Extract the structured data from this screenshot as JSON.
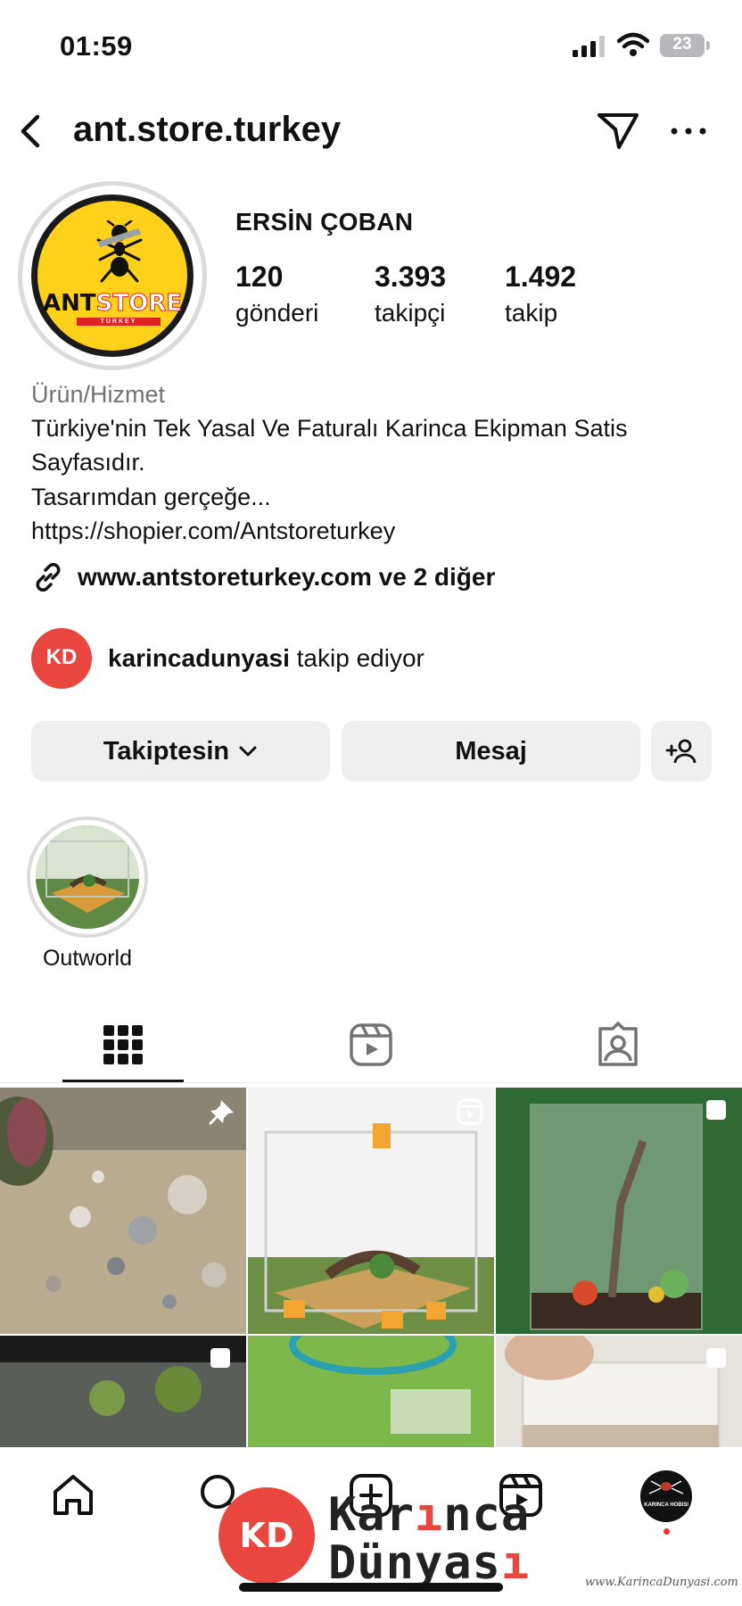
{
  "status_bar": {
    "time": "01:59",
    "battery": "23"
  },
  "header": {
    "username": "ant.store.turkey"
  },
  "profile": {
    "avatar_brand_left": "ANT",
    "avatar_brand_right": "STORE",
    "avatar_sub": "TURKEY",
    "display_name": "ERSİN ÇOBAN",
    "stats": [
      {
        "value": "120",
        "label": "gönderi"
      },
      {
        "value": "3.393",
        "label": "takipçi"
      },
      {
        "value": "1.492",
        "label": "takip"
      }
    ],
    "category": "Ürün/Hizmet",
    "bio_lines": [
      "Türkiye'nin Tek Yasal Ve Faturalı Karinca Ekipman Satis",
      "Sayfasıdır.",
      "Tasarımdan gerçeğe...",
      "https://shopier.com/Antstoreturkey"
    ],
    "link_text": "www.antstoreturkey.com ve 2 diğer",
    "mutual": {
      "avatar_text": "KD",
      "name": "karincadunyasi",
      "suffix": "takip ediyor"
    }
  },
  "actions": {
    "follow_label": "Takiptesin",
    "message_label": "Mesaj"
  },
  "highlights": [
    {
      "label": "Outworld"
    }
  ],
  "tabs": [
    {
      "name": "grid",
      "icon": "grid-icon",
      "active": true
    },
    {
      "name": "reels",
      "icon": "reels-icon",
      "active": false
    },
    {
      "name": "tagged",
      "icon": "tagged-icon",
      "active": false
    }
  ],
  "bottom_nav": {
    "profile_mini_text": "KARINCA HOBISI"
  },
  "watermark": {
    "logo": "KD",
    "line1_a": "Kar",
    "line1_b": "ı",
    "line1_c": "nca",
    "line2_a": "Dünyas",
    "line2_b": "ı",
    "url": "www.KarincaDunyasi.com"
  },
  "colors": {
    "accent_red": "#e8463e",
    "button_bg": "#efefef",
    "avatar_yellow": "#ffd11a"
  }
}
